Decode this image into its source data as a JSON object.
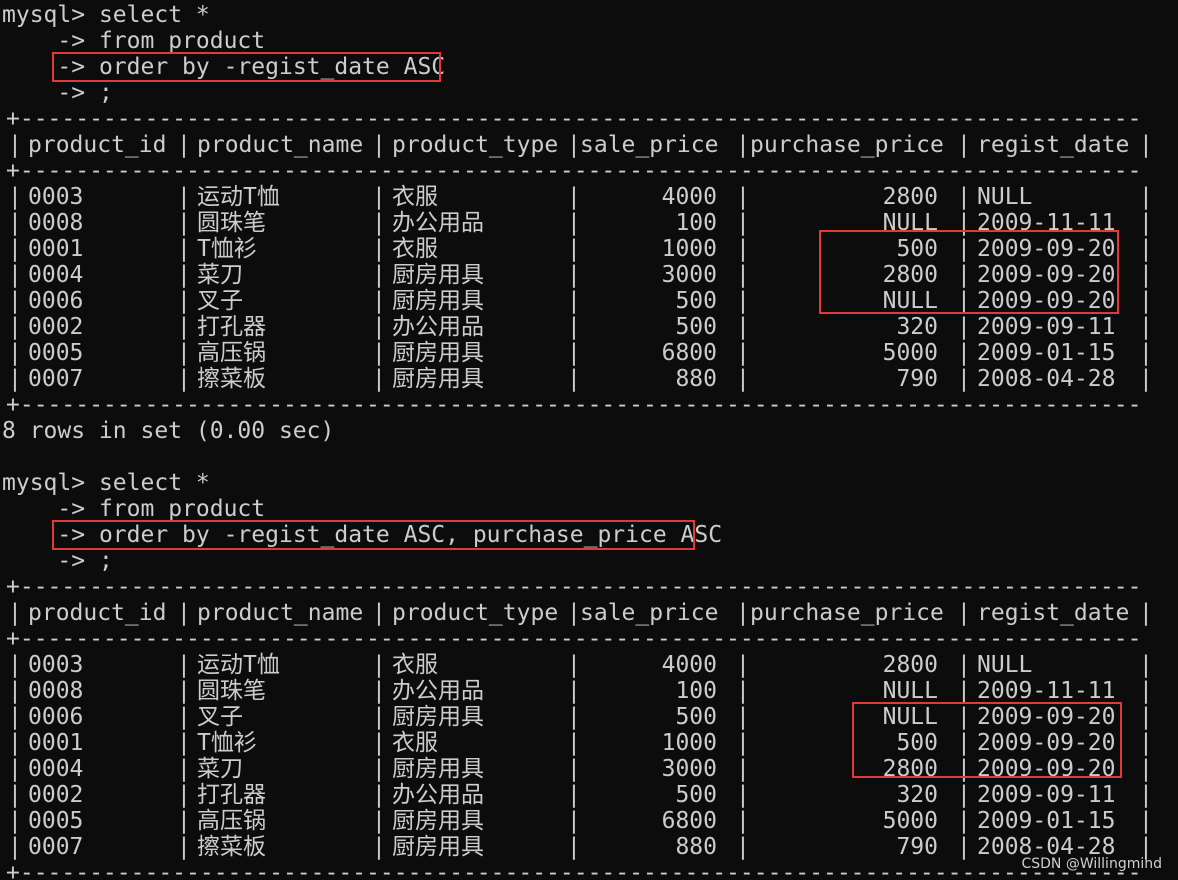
{
  "prompt": {
    "main": "mysql>",
    "cont": "->"
  },
  "query1": {
    "l1": "select *",
    "l2": "from product",
    "l3": "order by -regist_date ASC",
    "l4": ";"
  },
  "query2": {
    "l1": "select *",
    "l2": "from product",
    "l3": "order by -regist_date ASC, purchase_price ASC",
    "l4": ";"
  },
  "columns": [
    "product_id",
    "product_name",
    "product_type",
    "sale_price",
    "purchase_price",
    "regist_date"
  ],
  "table1": [
    [
      "0003",
      "运动T恤",
      "衣服",
      "4000",
      "2800",
      "NULL"
    ],
    [
      "0008",
      "圆珠笔",
      "办公用品",
      "100",
      "NULL",
      "2009-11-11"
    ],
    [
      "0001",
      "T恤衫",
      "衣服",
      "1000",
      "500",
      "2009-09-20"
    ],
    [
      "0004",
      "菜刀",
      "厨房用具",
      "3000",
      "2800",
      "2009-09-20"
    ],
    [
      "0006",
      "叉子",
      "厨房用具",
      "500",
      "NULL",
      "2009-09-20"
    ],
    [
      "0002",
      "打孔器",
      "办公用品",
      "500",
      "320",
      "2009-09-11"
    ],
    [
      "0005",
      "高压锅",
      "厨房用具",
      "6800",
      "5000",
      "2009-01-15"
    ],
    [
      "0007",
      "擦菜板",
      "厨房用具",
      "880",
      "790",
      "2008-04-28"
    ]
  ],
  "result1": "8 rows in set (0.00 sec)",
  "table2": [
    [
      "0003",
      "运动T恤",
      "衣服",
      "4000",
      "2800",
      "NULL"
    ],
    [
      "0008",
      "圆珠笔",
      "办公用品",
      "100",
      "NULL",
      "2009-11-11"
    ],
    [
      "0006",
      "叉子",
      "厨房用具",
      "500",
      "NULL",
      "2009-09-20"
    ],
    [
      "0001",
      "T恤衫",
      "衣服",
      "1000",
      "500",
      "2009-09-20"
    ],
    [
      "0004",
      "菜刀",
      "厨房用具",
      "3000",
      "2800",
      "2009-09-20"
    ],
    [
      "0002",
      "打孔器",
      "办公用品",
      "500",
      "320",
      "2009-09-11"
    ],
    [
      "0005",
      "高压锅",
      "厨房用具",
      "6800",
      "5000",
      "2009-01-15"
    ],
    [
      "0007",
      "擦菜板",
      "厨房用具",
      "880",
      "790",
      "2008-04-28"
    ]
  ],
  "watermark": "CSDN @Willingmind",
  "colors": {
    "background": "#0c0c0c",
    "text": "#cccccc",
    "highlight": "#e03a3a"
  }
}
